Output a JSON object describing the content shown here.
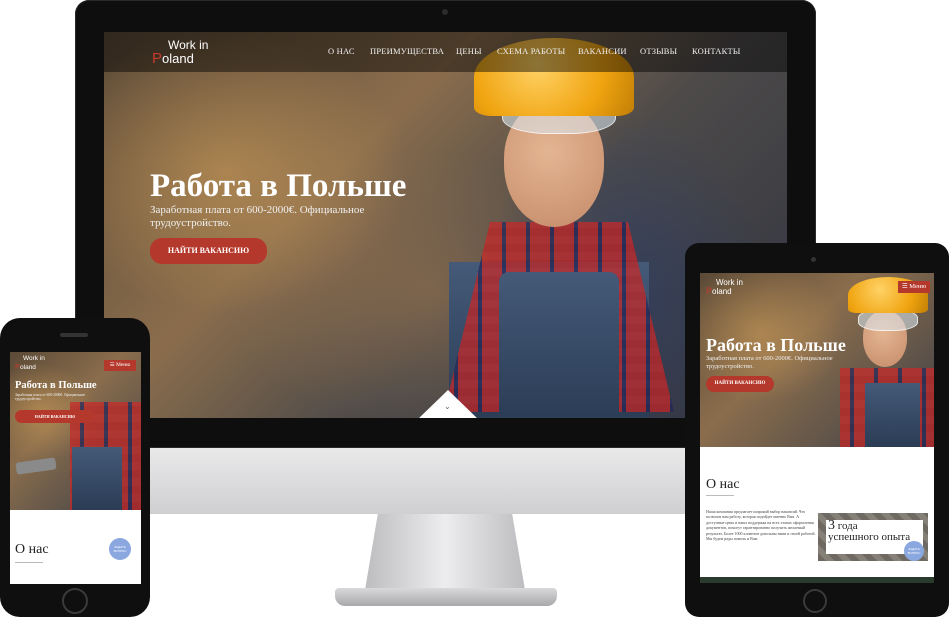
{
  "brand": {
    "logo_line1": "Work in",
    "logo_p": "P",
    "logo_line2": "oland"
  },
  "nav": {
    "items": [
      "О НАС",
      "ПРЕИМУЩЕСТВА",
      "ЦЕНЫ",
      "СХЕМА РАБОТЫ",
      "ВАКАНСИИ",
      "ОТЗЫВЫ",
      "КОНТАКТЫ"
    ]
  },
  "hero": {
    "title": "Работа в Польше",
    "subtitle": "Заработная плата от 600-2000€. Официальное трудоустройство.",
    "cta": "НАЙТИ ВАКАНСИЮ"
  },
  "mobile": {
    "menu_label": "☰ Меню",
    "chat_label": "ЗАДАТЬ ВОПРОС"
  },
  "about": {
    "heading": "О нас",
    "paragraph": "Наша компания предлагает широкий выбор вакансий. Что позволит вам работу, которая подойдет именно Вам. А доступные цены и наша поддержка на всех этапах оформления документов, помогут гарантированно получить желаемый результат. Более 1000 клиентов довольны нами и своей работой. Мы будем рады помочь и Вам.",
    "badge_number": "3",
    "badge_line1": "года",
    "badge_line2": "успешного опыта"
  },
  "colors": {
    "accent": "#b5382c",
    "logo_red": "#c83a2d",
    "chat": "#8aa7e0"
  },
  "icons": {
    "apple": "apple-logo-icon",
    "scroll": "chevron-down-icon"
  }
}
